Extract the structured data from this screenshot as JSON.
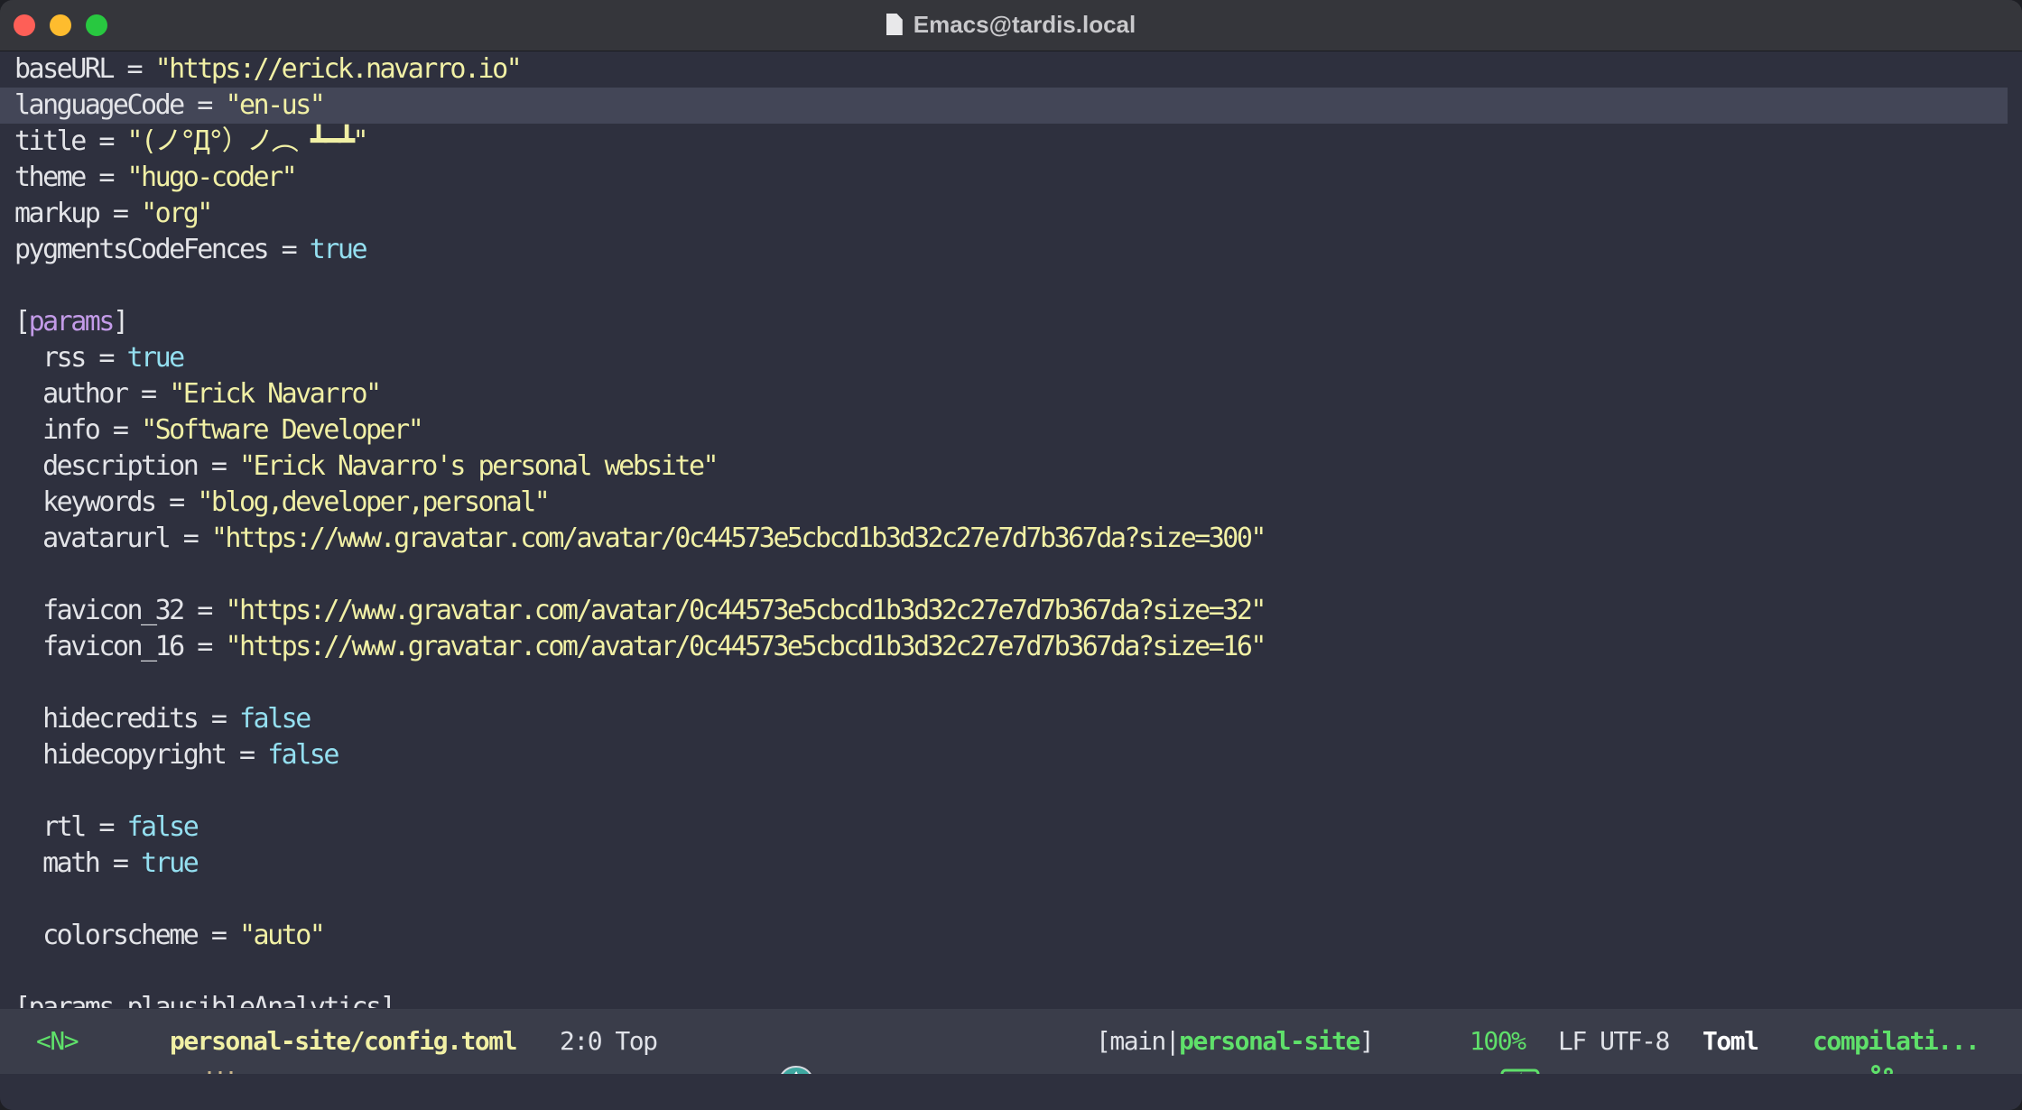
{
  "window": {
    "title": "Emacs@tardis.local"
  },
  "editor": {
    "lines": [
      [
        {
          "t": "baseURL = ",
          "c": "k"
        },
        {
          "t": "\"https://erick.navarro.io\"",
          "c": "s"
        }
      ],
      [
        {
          "t": "languageCode = ",
          "c": "k"
        },
        {
          "t": "\"en-us\"",
          "c": "s"
        }
      ],
      [
        {
          "t": "title = ",
          "c": "k"
        },
        {
          "t": "\"(ノ°Д°）ノ︵ ┻━┻\"",
          "c": "s"
        }
      ],
      [
        {
          "t": "theme = ",
          "c": "k"
        },
        {
          "t": "\"hugo-coder\"",
          "c": "s"
        }
      ],
      [
        {
          "t": "markup = ",
          "c": "k"
        },
        {
          "t": "\"org\"",
          "c": "s"
        }
      ],
      [
        {
          "t": "pygmentsCodeFences = ",
          "c": "k"
        },
        {
          "t": "true",
          "c": "b"
        }
      ],
      [],
      [
        {
          "t": "[",
          "c": "k"
        },
        {
          "t": "params",
          "c": "tbl"
        },
        {
          "t": "]",
          "c": "k"
        }
      ],
      [
        {
          "t": "  rss = ",
          "c": "k"
        },
        {
          "t": "true",
          "c": "b"
        }
      ],
      [
        {
          "t": "  author = ",
          "c": "k"
        },
        {
          "t": "\"Erick Navarro\"",
          "c": "s"
        }
      ],
      [
        {
          "t": "  info = ",
          "c": "k"
        },
        {
          "t": "\"Software Developer\"",
          "c": "s"
        }
      ],
      [
        {
          "t": "  description = ",
          "c": "k"
        },
        {
          "t": "\"Erick Navarro's personal website\"",
          "c": "s"
        }
      ],
      [
        {
          "t": "  keywords = ",
          "c": "k"
        },
        {
          "t": "\"blog,developer,personal\"",
          "c": "s"
        }
      ],
      [
        {
          "t": "  avatarurl = ",
          "c": "k"
        },
        {
          "t": "\"https://www.gravatar.com/avatar/0c44573e5cbcd1b3d32c27e7d7b367da?size=300\"",
          "c": "s"
        }
      ],
      [],
      [
        {
          "t": "  favicon_32 = ",
          "c": "k"
        },
        {
          "t": "\"https://www.gravatar.com/avatar/0c44573e5cbcd1b3d32c27e7d7b367da?size=32\"",
          "c": "s"
        }
      ],
      [
        {
          "t": "  favicon_16 = ",
          "c": "k"
        },
        {
          "t": "\"https://www.gravatar.com/avatar/0c44573e5cbcd1b3d32c27e7d7b367da?size=16\"",
          "c": "s"
        }
      ],
      [],
      [
        {
          "t": "  hidecredits = ",
          "c": "k"
        },
        {
          "t": "false",
          "c": "b"
        }
      ],
      [
        {
          "t": "  hidecopyright = ",
          "c": "k"
        },
        {
          "t": "false",
          "c": "b"
        }
      ],
      [],
      [
        {
          "t": "  rtl = ",
          "c": "k"
        },
        {
          "t": "false",
          "c": "b"
        }
      ],
      [
        {
          "t": "  math = ",
          "c": "k"
        },
        {
          "t": "true",
          "c": "b"
        }
      ],
      [],
      [
        {
          "t": "  colorscheme = ",
          "c": "k"
        },
        {
          "t": "\"auto\"",
          "c": "s"
        }
      ],
      [],
      [
        {
          "t": "[params.plausibleAnalytics]",
          "c": "k"
        }
      ]
    ],
    "highlighted_line": 2
  },
  "modeline": {
    "evil_state": "<N>",
    "buffer_name": "personal-site/config.toml",
    "position": "2:0 Top",
    "vcs_open": "[",
    "vcs_branch": "main",
    "vcs_sep": "|",
    "vcs_project": "personal-site",
    "vcs_close": "]",
    "battery": "100%",
    "encoding": "LF UTF-8",
    "major_mode": "Toml",
    "compilation": "compilati..."
  },
  "colors": {
    "background": "#2e303e",
    "string": "#f1f0a5",
    "boolean": "#94dff0",
    "table_header": "#c39be8",
    "modeline_green": "#5fe06a"
  }
}
